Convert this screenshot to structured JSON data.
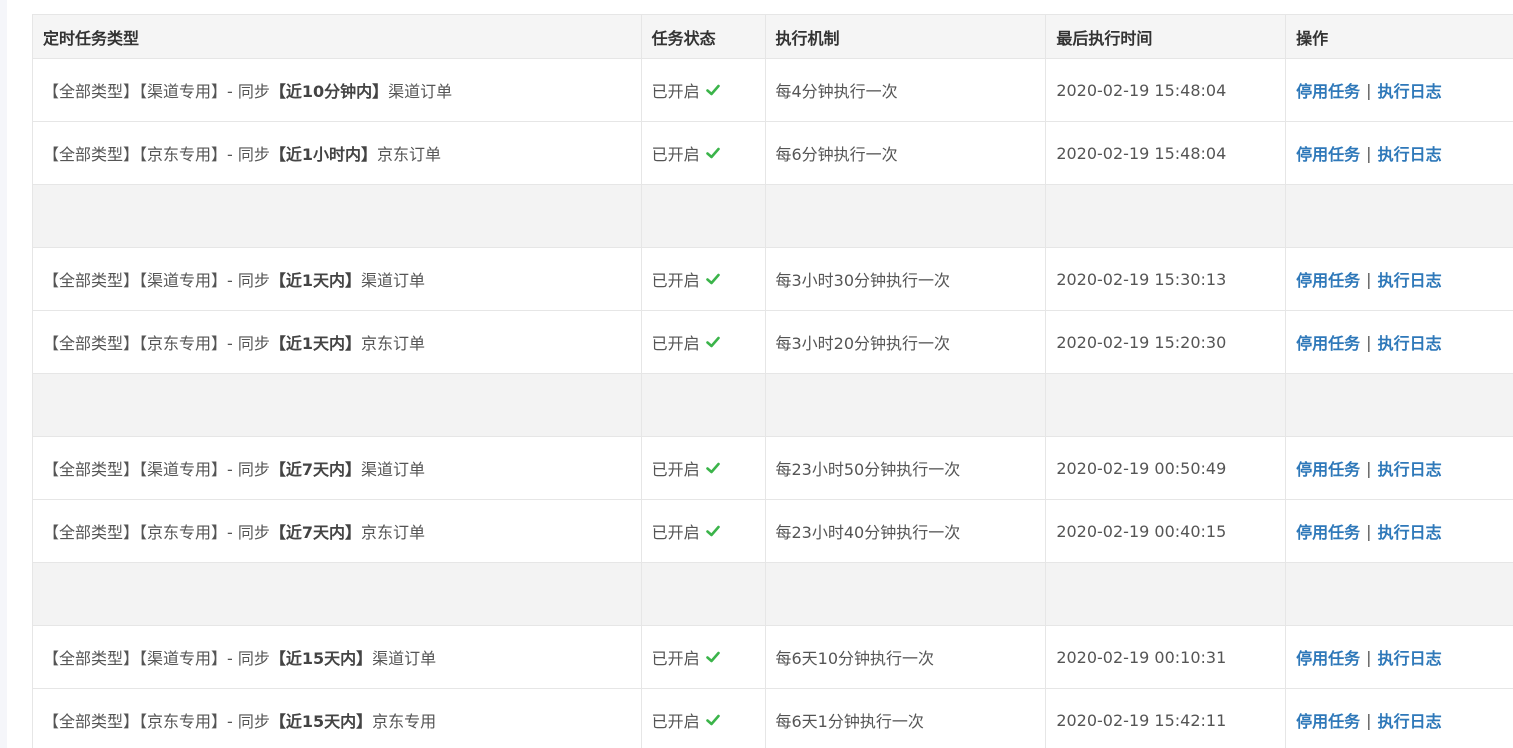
{
  "headers": {
    "task_type": "定时任务类型",
    "status": "任务状态",
    "mechanism": "执行机制",
    "last_time": "最后执行时间",
    "action": "操作"
  },
  "rows": [
    {
      "prefix": "【全部类型】【渠道专用】- 同步",
      "range": "【近10分钟内】",
      "target": "渠道订单",
      "status": "已开启",
      "mechanism": "每4分钟执行一次",
      "last_time": "2020-02-19 15:48:04",
      "action_stop": "停用任务",
      "action_log": "执行日志",
      "separator": "|"
    },
    {
      "prefix": "【全部类型】【京东专用】- 同步",
      "range": "【近1小时内】",
      "target": "京东订单",
      "status": "已开启",
      "mechanism": "每6分钟执行一次",
      "last_time": "2020-02-19 15:48:04",
      "action_stop": "停用任务",
      "action_log": "执行日志",
      "separator": "|"
    },
    {
      "prefix": "【全部类型】【渠道专用】- 同步",
      "range": "【近1天内】",
      "target": "渠道订单",
      "status": "已开启",
      "mechanism": "每3小时30分钟执行一次",
      "last_time": "2020-02-19 15:30:13",
      "action_stop": "停用任务",
      "action_log": "执行日志",
      "separator": "|"
    },
    {
      "prefix": "【全部类型】【京东专用】- 同步",
      "range": "【近1天内】",
      "target": "京东订单",
      "status": "已开启",
      "mechanism": "每3小时20分钟执行一次",
      "last_time": "2020-02-19 15:20:30",
      "action_stop": "停用任务",
      "action_log": "执行日志",
      "separator": "|"
    },
    {
      "prefix": "【全部类型】【渠道专用】- 同步",
      "range": "【近7天内】",
      "target": "渠道订单",
      "status": "已开启",
      "mechanism": "每23小时50分钟执行一次",
      "last_time": "2020-02-19 00:50:49",
      "action_stop": "停用任务",
      "action_log": "执行日志",
      "separator": "|"
    },
    {
      "prefix": "【全部类型】【京东专用】- 同步",
      "range": "【近7天内】",
      "target": "京东订单",
      "status": "已开启",
      "mechanism": "每23小时40分钟执行一次",
      "last_time": "2020-02-19 00:40:15",
      "action_stop": "停用任务",
      "action_log": "执行日志",
      "separator": "|"
    },
    {
      "prefix": "【全部类型】【渠道专用】- 同步",
      "range": "【近15天内】",
      "target": "渠道订单",
      "status": "已开启",
      "mechanism": "每6天10分钟执行一次",
      "last_time": "2020-02-19 00:10:31",
      "action_stop": "停用任务",
      "action_log": "执行日志",
      "separator": "|"
    },
    {
      "prefix": "【全部类型】【京东专用】- 同步",
      "range": "【近15天内】",
      "target": "京东专用",
      "status": "已开启",
      "mechanism": "每6天1分钟执行一次",
      "last_time": "2020-02-19 15:42:11",
      "action_stop": "停用任务",
      "action_log": "执行日志",
      "separator": "|"
    }
  ],
  "icons": {
    "status_icon": "check-icon"
  },
  "colors": {
    "check_green": "#3bb44a",
    "link_blue": "#2e78b9",
    "header_bg": "#f5f5f5",
    "spacer_bg": "#f3f3f3",
    "border": "#e6e6e6"
  }
}
